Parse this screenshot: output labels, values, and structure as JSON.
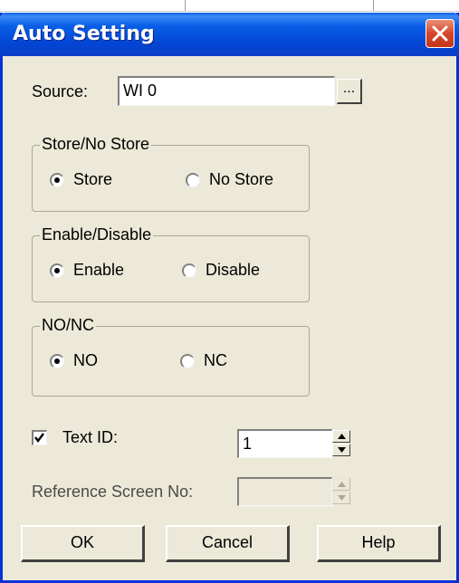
{
  "dialog": {
    "title": "Auto Setting",
    "source_label": "Source:",
    "source_value": "WI 0",
    "browse_label": "...",
    "store_group": {
      "title": "Store/No Store",
      "options": [
        {
          "label": "Store",
          "selected": true
        },
        {
          "label": "No Store",
          "selected": false
        }
      ]
    },
    "enable_group": {
      "title": "Enable/Disable",
      "options": [
        {
          "label": "Enable",
          "selected": true
        },
        {
          "label": "Disable",
          "selected": false
        }
      ]
    },
    "nonc_group": {
      "title": "NO/NC",
      "options": [
        {
          "label": "NO",
          "selected": true
        },
        {
          "label": "NC",
          "selected": false
        }
      ]
    },
    "text_id": {
      "label": "Text ID:",
      "checked": true,
      "value": "1"
    },
    "reference_screen": {
      "label": "Reference Screen No:",
      "value": "",
      "enabled": false
    },
    "buttons": {
      "ok": "OK",
      "cancel": "Cancel",
      "help": "Help"
    }
  },
  "colors": {
    "titlebar": "#0a5fe6",
    "dialog_bg": "#ece9d8",
    "close_button": "#d6462a"
  }
}
